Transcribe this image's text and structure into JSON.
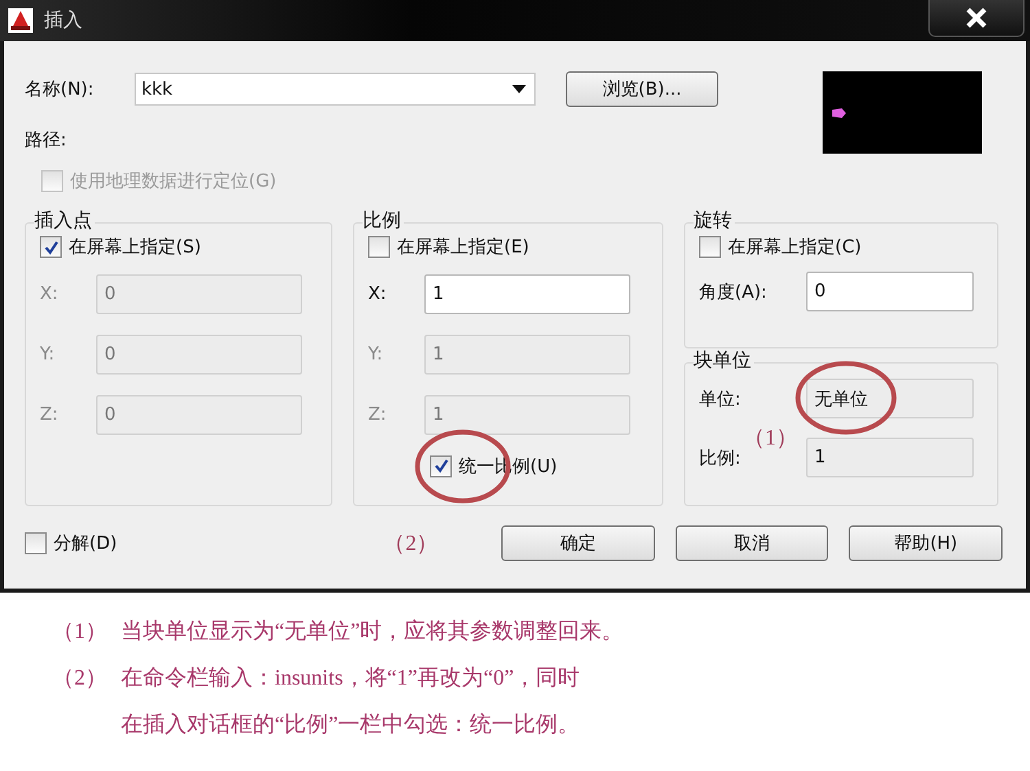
{
  "window": {
    "title": "插入"
  },
  "name_field": {
    "label": "名称(N):",
    "value": "kkk"
  },
  "browse_button": {
    "label": "浏览(B)..."
  },
  "path": {
    "label": "路径:"
  },
  "geo_checkbox": {
    "label": "使用地理数据进行定位(G)",
    "checked": false,
    "disabled": true
  },
  "insertion_point": {
    "title": "插入点",
    "on_screen": {
      "label": "在屏幕上指定(S)",
      "checked": true
    },
    "fields": [
      {
        "label": "X:",
        "value": "0",
        "disabled": true
      },
      {
        "label": "Y:",
        "value": "0",
        "disabled": true
      },
      {
        "label": "Z:",
        "value": "0",
        "disabled": true
      }
    ]
  },
  "scale": {
    "title": "比例",
    "on_screen": {
      "label": "在屏幕上指定(E)",
      "checked": false
    },
    "fields": [
      {
        "label": "X:",
        "value": "1",
        "disabled": false
      },
      {
        "label": "Y:",
        "value": "1",
        "disabled": true
      },
      {
        "label": "Z:",
        "value": "1",
        "disabled": true
      }
    ],
    "uniform": {
      "label": "统一比例(U)",
      "checked": true,
      "highlighted": true,
      "marker": "（2）"
    }
  },
  "rotation": {
    "title": "旋转",
    "on_screen": {
      "label": "在屏幕上指定(C)",
      "checked": false
    },
    "angle": {
      "label": "角度(A):",
      "value": "0"
    }
  },
  "block_unit": {
    "title": "块单位",
    "unit": {
      "label": "单位:",
      "value": "无单位",
      "highlighted": true,
      "marker": "（1）"
    },
    "factor": {
      "label": "比例:",
      "value": "1"
    }
  },
  "explode": {
    "label": "分解(D)",
    "checked": false
  },
  "buttons": [
    {
      "label": "确定"
    },
    {
      "label": "取消"
    },
    {
      "label": "帮助(H)"
    }
  ],
  "notes": [
    {
      "number": "（1）",
      "lines": [
        "当块单位显示为“无单位”时，应将其参数调整回来。"
      ]
    },
    {
      "number": "（2）",
      "lines": [
        "在命令栏输入：insunits，将“1”再改为“0”，同时",
        "在插入对话框的“比例”一栏中勾选：统一比例。"
      ]
    }
  ]
}
